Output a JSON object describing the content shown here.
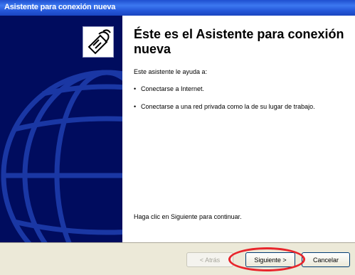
{
  "window": {
    "title": "Asistente para conexión nueva"
  },
  "content": {
    "heading": "Éste es el Asistente para conexión nueva",
    "intro": "Este asistente le ayuda a:",
    "bullets": [
      "Conectarse a Internet.",
      "Conectarse a una red privada como la de su lugar de trabajo."
    ],
    "footer": "Haga clic en Siguiente para continuar."
  },
  "buttons": {
    "back": "< Atrás",
    "next": "Siguiente >",
    "cancel": "Cancelar"
  },
  "icons": {
    "wizard": "phone-handset-icon",
    "globe": "globe-icon"
  },
  "colors": {
    "titlebar": "#2456d8",
    "left_panel": "#000c5e",
    "highlight": "#e8252b"
  }
}
